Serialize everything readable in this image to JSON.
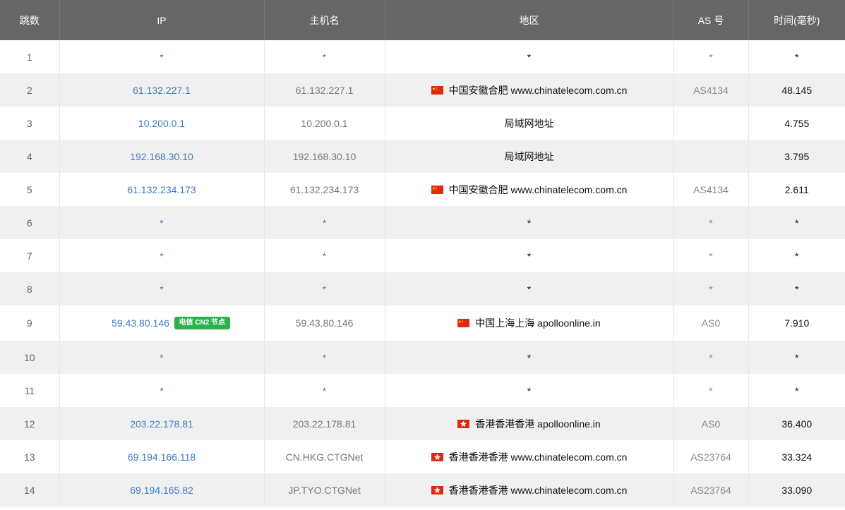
{
  "headers": {
    "hop": "跳数",
    "ip": "IP",
    "hostname": "主机名",
    "region": "地区",
    "as": "AS 号",
    "time": "时间(毫秒)"
  },
  "rows": [
    {
      "hop": "1",
      "ip": "*",
      "hostname": "*",
      "flag": "",
      "region": "*",
      "as": "*",
      "time": "*"
    },
    {
      "hop": "2",
      "ip": "61.132.227.1",
      "hostname": "61.132.227.1",
      "flag": "cn",
      "region": "中国安徽合肥 www.chinatelecom.com.cn",
      "as": "AS4134",
      "time": "48.145"
    },
    {
      "hop": "3",
      "ip": "10.200.0.1",
      "hostname": "10.200.0.1",
      "flag": "",
      "region": "局域网地址",
      "as": "",
      "time": "4.755"
    },
    {
      "hop": "4",
      "ip": "192.168.30.10",
      "hostname": "192.168.30.10",
      "flag": "",
      "region": "局域网地址",
      "as": "",
      "time": "3.795"
    },
    {
      "hop": "5",
      "ip": "61.132.234.173",
      "hostname": "61.132.234.173",
      "flag": "cn",
      "region": "中国安徽合肥 www.chinatelecom.com.cn",
      "as": "AS4134",
      "time": "2.611"
    },
    {
      "hop": "6",
      "ip": "*",
      "hostname": "*",
      "flag": "",
      "region": "*",
      "as": "*",
      "time": "*"
    },
    {
      "hop": "7",
      "ip": "*",
      "hostname": "*",
      "flag": "",
      "region": "*",
      "as": "*",
      "time": "*"
    },
    {
      "hop": "8",
      "ip": "*",
      "hostname": "*",
      "flag": "",
      "region": "*",
      "as": "*",
      "time": "*"
    },
    {
      "hop": "9",
      "ip": "59.43.80.146",
      "badge": "电信 CN2 节点",
      "hostname": "59.43.80.146",
      "flag": "cn",
      "region": "中国上海上海 apolloonline.in",
      "as": "AS0",
      "time": "7.910"
    },
    {
      "hop": "10",
      "ip": "*",
      "hostname": "*",
      "flag": "",
      "region": "*",
      "as": "*",
      "time": "*"
    },
    {
      "hop": "11",
      "ip": "*",
      "hostname": "*",
      "flag": "",
      "region": "*",
      "as": "*",
      "time": "*"
    },
    {
      "hop": "12",
      "ip": "203.22.178.81",
      "hostname": "203.22.178.81",
      "flag": "hk",
      "region": "香港香港香港 apolloonline.in",
      "as": "AS0",
      "time": "36.400"
    },
    {
      "hop": "13",
      "ip": "69.194.166.118",
      "hostname": "CN.HKG.CTGNet",
      "flag": "hk",
      "region": "香港香港香港 www.chinatelecom.com.cn",
      "as": "AS23764",
      "time": "33.324"
    },
    {
      "hop": "14",
      "ip": "69.194.165.82",
      "hostname": "JP.TYO.CTGNet",
      "flag": "hk",
      "region": "香港香港香港 www.chinatelecom.com.cn",
      "as": "AS23764",
      "time": "33.090"
    }
  ],
  "colors": {
    "header_bg": "#666666",
    "row_alt_bg": "#f0f0f0",
    "link": "#3d7cc0",
    "badge_bg": "#2bb24c",
    "flag_cn": "#de2910",
    "flag_hk": "#de2910"
  }
}
